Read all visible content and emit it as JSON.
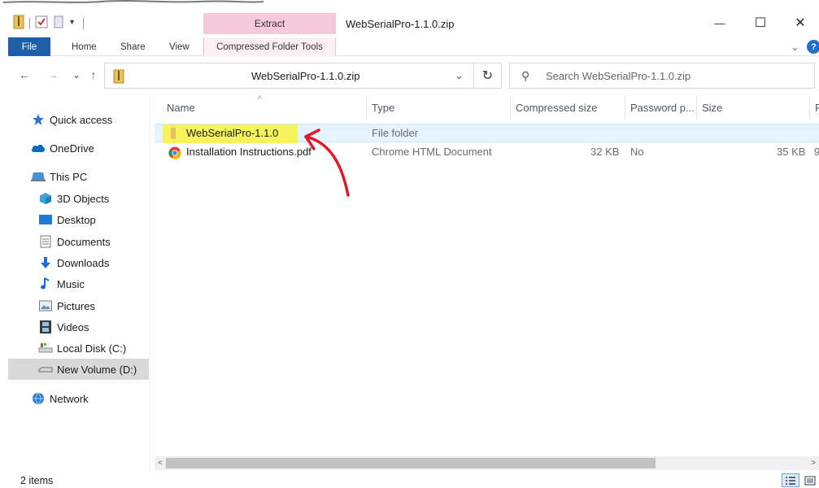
{
  "window": {
    "title": "WebSerialPro-1.1.0.zip",
    "contextual_tab": "Extract",
    "minimize_glyph": "—",
    "maximize_glyph": "☐",
    "close_glyph": "✕",
    "quick_access_dropdown": "▾"
  },
  "ribbon": {
    "tabs": [
      {
        "label": "File"
      },
      {
        "label": "Home"
      },
      {
        "label": "Share"
      },
      {
        "label": "View"
      },
      {
        "label": "Compressed Folder Tools"
      }
    ],
    "expand_glyph": "⌄",
    "help_glyph": "?"
  },
  "address": {
    "path": "WebSerialPro-1.1.0.zip",
    "back_glyph": "←",
    "forward_glyph": "→",
    "recent_glyph": "⌄",
    "up_glyph": "↑",
    "dropdown_glyph": "⌄",
    "refresh_glyph": "↻",
    "search_placeholder": "Search WebSerialPro-1.1.0.zip",
    "search_glyph": "⚲"
  },
  "nav": {
    "items": [
      {
        "label": "Quick access",
        "icon": "star-icon"
      },
      {
        "label": "OneDrive",
        "icon": "cloud-icon"
      },
      {
        "label": "This PC",
        "icon": "computer-icon"
      },
      {
        "label": "3D Objects",
        "icon": "cube-icon"
      },
      {
        "label": "Desktop",
        "icon": "desktop-icon"
      },
      {
        "label": "Documents",
        "icon": "document-icon"
      },
      {
        "label": "Downloads",
        "icon": "download-icon"
      },
      {
        "label": "Music",
        "icon": "music-icon"
      },
      {
        "label": "Pictures",
        "icon": "picture-icon"
      },
      {
        "label": "Videos",
        "icon": "film-icon"
      },
      {
        "label": "Local Disk (C:)",
        "icon": "drive-icon"
      },
      {
        "label": "New Volume (D:)",
        "icon": "drive-icon",
        "selected": true
      },
      {
        "label": "Network",
        "icon": "network-icon"
      }
    ]
  },
  "columns": [
    {
      "label": "Name",
      "sort_glyph": "^"
    },
    {
      "label": "Type"
    },
    {
      "label": "Compressed size"
    },
    {
      "label": "Password p..."
    },
    {
      "label": "Size"
    },
    {
      "label": "R"
    }
  ],
  "files": [
    {
      "name": "WebSerialPro-1.1.0",
      "type": "File folder",
      "compressed_size": "",
      "password": "",
      "size": "",
      "icon": "folder-icon"
    },
    {
      "name": "Installation Instructions.pdf",
      "type": "Chrome HTML Document",
      "compressed_size": "32 KB",
      "password": "No",
      "size": "35 KB",
      "ratio_fragment": "9",
      "icon": "chrome-icon"
    }
  ],
  "scrollbar": {
    "left_glyph": "<",
    "right_glyph": ">"
  },
  "status": {
    "item_count": "2 items"
  },
  "colors": {
    "accent": "#1f5fa8",
    "extract_tab": "#f6c8dc",
    "highlight": "#f7f35a",
    "annotation": "#e0182a",
    "selection": "#e5f3ff"
  }
}
